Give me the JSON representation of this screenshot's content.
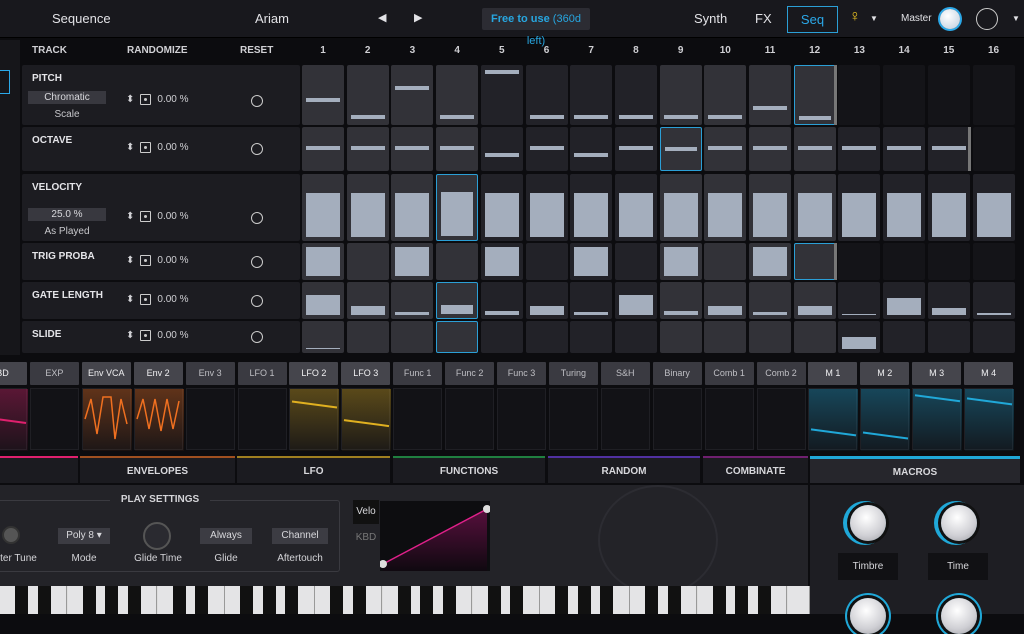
{
  "topbar": {
    "section": "Sequence",
    "preset": "Ariam",
    "prev_icon": "triangle-left",
    "next_icon": "triangle-right",
    "license": "Free to use",
    "license_sub": "(360d left)",
    "tabs": [
      "Synth",
      "FX",
      "Seq"
    ],
    "active_tab": "Seq",
    "bulb_icon": "lightbulb",
    "master": "Master",
    "midi_icon": "midi-port"
  },
  "colors": {
    "accent": "#2ba8e8",
    "bar": "#a4aebd",
    "bulb": "#e8c020"
  },
  "headers": {
    "track": "TRACK",
    "randomize": "RANDOMIZE",
    "reset": "RESET",
    "steps": [
      "1",
      "2",
      "3",
      "4",
      "5",
      "6",
      "7",
      "8",
      "9",
      "10",
      "11",
      "12",
      "13",
      "14",
      "15",
      "16"
    ]
  },
  "tracks": [
    {
      "label": "PITCH",
      "select": "Chromatic",
      "sub": "Scale",
      "rand": "0.00 %",
      "length": 12,
      "selected": 12,
      "style": "line",
      "values": [
        0.38,
        0.05,
        0.62,
        0.05,
        0.95,
        0.05,
        0.05,
        0.05,
        0.05,
        0.05,
        0.22,
        0.05,
        null,
        null,
        null,
        null
      ]
    },
    {
      "label": "OCTAVE",
      "rand": "0.00 %",
      "length": 15,
      "selected": 9,
      "style": "line",
      "values": [
        0.5,
        0.5,
        0.5,
        0.5,
        0.3,
        0.5,
        0.3,
        0.5,
        0.5,
        0.5,
        0.5,
        0.5,
        0.5,
        0.5,
        0.5,
        null
      ]
    },
    {
      "label": "VELOCITY",
      "select": "25.0 %",
      "sub": "As Played",
      "rand": "0.00 %",
      "length": 16,
      "selected": 4,
      "style": "fill",
      "values": [
        0.75,
        0.75,
        0.75,
        0.75,
        0.75,
        0.75,
        0.75,
        0.75,
        0.75,
        0.75,
        0.75,
        0.75,
        0.75,
        0.75,
        0.75,
        0.75
      ]
    },
    {
      "label": "TRIG PROBA",
      "rand": "0.00 %",
      "length": 12,
      "selected": 12,
      "style": "fill",
      "values": [
        1,
        0,
        1,
        0,
        1,
        0,
        1,
        0,
        1,
        0,
        1,
        0,
        0,
        0,
        0,
        0
      ]
    },
    {
      "label": "GATE LENGTH",
      "rand": "0.00 %",
      "length": 16,
      "selected": 4,
      "style": "fill",
      "values": [
        0.7,
        0.3,
        0.1,
        0.3,
        0.15,
        0.3,
        0.12,
        0.7,
        0.15,
        0.3,
        0.12,
        0.3,
        0.02,
        0.6,
        0.25,
        0.08
      ]
    },
    {
      "label": "SLIDE",
      "rand": "0.00 %",
      "length": 16,
      "selected": 4,
      "style": "fill",
      "values": [
        0.02,
        0,
        0,
        0,
        0,
        0,
        0,
        0,
        0,
        0,
        0,
        0,
        0.5,
        0,
        0,
        0
      ]
    }
  ],
  "mod_sources": [
    {
      "label": "BD",
      "on": true,
      "color": "#e0206e",
      "line": 0.5
    },
    {
      "label": "EXP"
    },
    {
      "label": "Env VCA",
      "on": true,
      "color": "#f07020",
      "wave": "env"
    },
    {
      "label": "Env 2",
      "on": true,
      "color": "#f07020",
      "wave": "saw"
    },
    {
      "label": "Env 3"
    },
    {
      "label": "LFO 1"
    },
    {
      "label": "LFO 2",
      "on": true,
      "color": "#e0b020",
      "line": 0.75
    },
    {
      "label": "LFO 3",
      "on": true,
      "color": "#e0b020",
      "line": 0.45
    },
    {
      "label": "Func 1"
    },
    {
      "label": "Func 2"
    },
    {
      "label": "Func 3"
    },
    {
      "label": "Turing"
    },
    {
      "label": "S&H"
    },
    {
      "label": "Binary"
    },
    {
      "label": "Comb 1"
    },
    {
      "label": "Comb 2"
    },
    {
      "label": "M 1",
      "on": true,
      "color": "#20a8d8",
      "line": 0.3
    },
    {
      "label": "M 2",
      "on": true,
      "color": "#20a8d8",
      "line": 0.25
    },
    {
      "label": "M 3",
      "on": true,
      "color": "#20a8d8",
      "line": 0.85
    },
    {
      "label": "M 4",
      "on": true,
      "color": "#20a8d8",
      "line": 0.8
    }
  ],
  "categories": [
    {
      "label": "",
      "color": "#e0206e"
    },
    {
      "label": "ENVELOPES",
      "color": "#a05020"
    },
    {
      "label": "LFO",
      "color": "#a08020"
    },
    {
      "label": "FUNCTIONS",
      "color": "#208040"
    },
    {
      "label": "RANDOM",
      "color": "#5030a0"
    },
    {
      "label": "COMBINATE",
      "color": "#702070"
    },
    {
      "label": "MACROS",
      "color": "#20a8d8",
      "active": true
    }
  ],
  "play_settings": {
    "title": "PLAY SETTINGS",
    "master_tune": "ster Tune",
    "mode_value": "Poly 8",
    "mode": "Mode",
    "glide_time": "Glide Time",
    "glide_value": "Always",
    "glide": "Glide",
    "aftertouch_value": "Channel",
    "aftertouch": "Aftertouch"
  },
  "curve": {
    "tabs": [
      "Velo",
      "KBD"
    ],
    "active": "Velo"
  },
  "macros": {
    "title": "MACROS",
    "knobs": [
      {
        "label": "Timbre"
      },
      {
        "label": "Time"
      }
    ]
  }
}
